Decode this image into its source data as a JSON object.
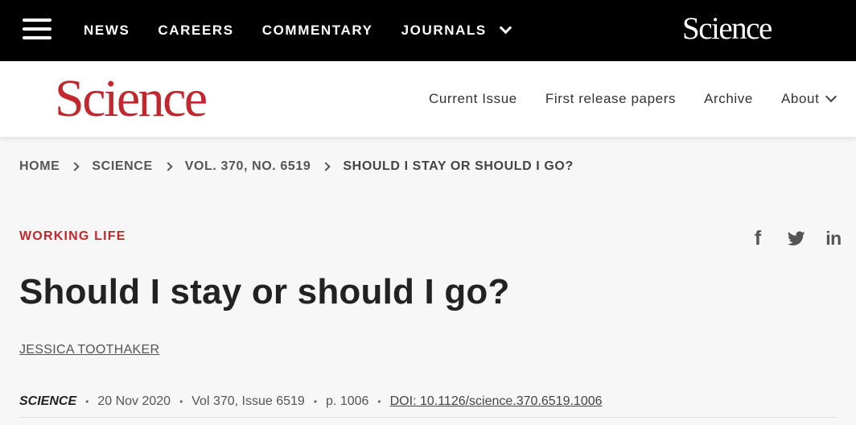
{
  "topbar": {
    "menu_icon": "hamburger-menu-icon",
    "nav": [
      {
        "label": "NEWS"
      },
      {
        "label": "CAREERS"
      },
      {
        "label": "COMMENTARY"
      },
      {
        "label": "JOURNALS",
        "has_dropdown": true
      }
    ],
    "brand": "Science",
    "background": "#000000"
  },
  "header": {
    "logo": "Science",
    "logo_color": "#c1272d",
    "nav": [
      {
        "label": "Current Issue"
      },
      {
        "label": "First release papers"
      },
      {
        "label": "Archive"
      },
      {
        "label": "About",
        "has_dropdown": true
      }
    ]
  },
  "breadcrumb": [
    "HOME",
    "SCIENCE",
    "VOL. 370, NO. 6519",
    "SHOULD I STAY OR SHOULD I GO?"
  ],
  "article": {
    "section": "WORKING LIFE",
    "title": "Should I stay or should I go?",
    "author": "JESSICA TOOTHAKER",
    "share": {
      "facebook_icon": "f",
      "twitter_icon": "twitter-icon",
      "linkedin_icon": "in"
    },
    "meta": {
      "journal": "SCIENCE",
      "date": "20 Nov 2020",
      "volume": "Vol 370, Issue 6519",
      "page": "p. 1006",
      "doi": "DOI: 10.1126/science.370.6519.1006",
      "separator": "•"
    }
  }
}
